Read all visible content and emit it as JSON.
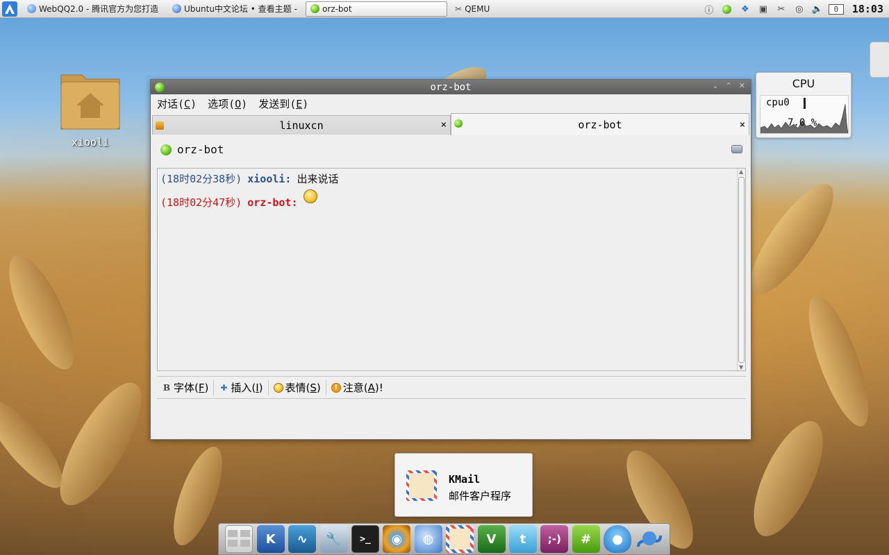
{
  "taskbar": {
    "tasks": [
      {
        "label": "WebQQ2.0 - 腾讯官方为您打造",
        "icon": "globe-icon",
        "color": "#3a78c8"
      },
      {
        "label": "Ubuntu中文论坛 • 查看主题 -",
        "icon": "globe-icon",
        "color": "#3a5fb0"
      },
      {
        "label": "orz-bot",
        "icon": "status-online-icon",
        "color": "#4fb010"
      },
      {
        "label": "QEMU",
        "icon": "qemu-icon",
        "color": "#555555"
      }
    ],
    "clock": "18:03",
    "tray_counter": "0"
  },
  "desktop": {
    "home_label": "xiooli"
  },
  "cpu_widget": {
    "title": "CPU",
    "label": "cpu0",
    "value": "7.0 %"
  },
  "window": {
    "title": "orz-bot",
    "menu": [
      {
        "label": "对话(",
        "key": "C",
        "end": ")"
      },
      {
        "label": "选项(",
        "key": "O",
        "end": ")"
      },
      {
        "label": "发送到(",
        "key": "E",
        "end": ")"
      }
    ],
    "tabs": [
      {
        "label": "linuxcn",
        "close": "×"
      },
      {
        "label": "orz-bot",
        "close": "×"
      }
    ],
    "contact": "orz-bot",
    "messages": [
      {
        "time": "(18时02分38秒)",
        "sender": "xiooli:",
        "text": "出来说话"
      },
      {
        "time": "(18时02分47秒)",
        "sender": "orz-bot:",
        "text": ""
      }
    ],
    "toolbar": [
      {
        "label": "字体(",
        "key": "F",
        "end": ")"
      },
      {
        "label": "插入(",
        "key": "I",
        "end": ")"
      },
      {
        "label": "表情(",
        "key": "S",
        "end": ")"
      },
      {
        "label": "注意(",
        "key": "A",
        "end": ")!"
      }
    ]
  },
  "notification": {
    "title": "KMail",
    "subtitle": "邮件客户程序"
  },
  "colors": {
    "self_message": "#2a4f8a",
    "other_message": "#c8141a",
    "online": "#4fb010"
  }
}
